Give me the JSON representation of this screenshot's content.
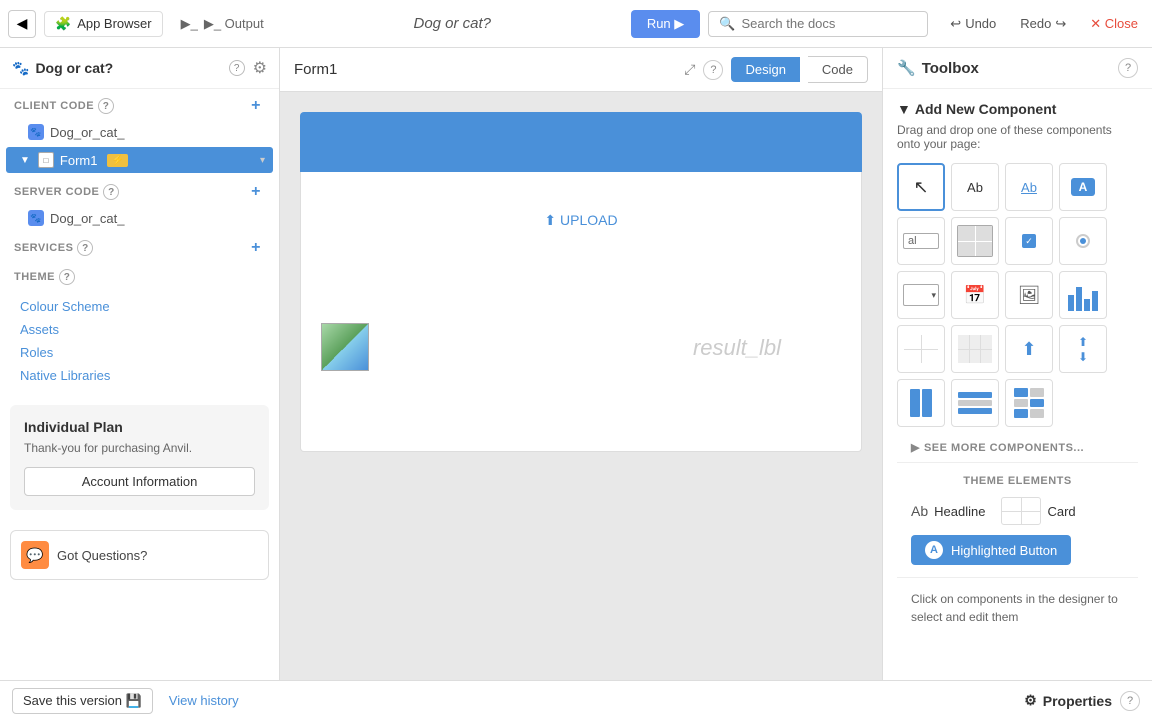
{
  "topbar": {
    "back_label": "◀",
    "app_browser_label": "App Browser",
    "output_label": "▶_ Output",
    "app_title": "Dog or cat?",
    "run_label": "Run ▶",
    "search_placeholder": "Search the docs",
    "undo_label": "Undo",
    "redo_label": "Redo",
    "close_label": "✕ Close"
  },
  "sidebar": {
    "app_title": "Dog or cat?",
    "client_code_label": "CLIENT CODE",
    "server_code_label": "SERVER CODE",
    "services_label": "SERVICES",
    "theme_label": "THEME",
    "client_module": "Dog_or_cat_",
    "server_module": "Dog_or_cat_",
    "form1_label": "Form1",
    "theme_links": [
      "Colour Scheme",
      "Assets",
      "Roles",
      "Native Libraries"
    ],
    "plan_title": "Individual Plan",
    "plan_desc": "Thank-you for purchasing Anvil.",
    "plan_btn": "Account Information",
    "got_questions": "Got Questions?"
  },
  "center": {
    "form_title": "Form1",
    "design_tab": "Design",
    "code_tab": "Code",
    "upload_text": "⬆ UPLOAD",
    "result_label": "result_lbl"
  },
  "toolbox": {
    "title": "Toolbox",
    "add_component_title": "Add New Component",
    "add_component_desc": "Drag and drop one of these components onto your page:",
    "see_more": "SEE MORE COMPONENTS...",
    "theme_elements_title": "THEME ELEMENTS",
    "headline_label": "Headline",
    "card_label": "Card",
    "highlighted_button_label": "Highlighted Button",
    "footer_text": "Click on components in the designer to select and edit them"
  },
  "bottom": {
    "save_label": "Save this version 💾",
    "view_history_label": "View history"
  },
  "properties": {
    "title": "Properties"
  }
}
